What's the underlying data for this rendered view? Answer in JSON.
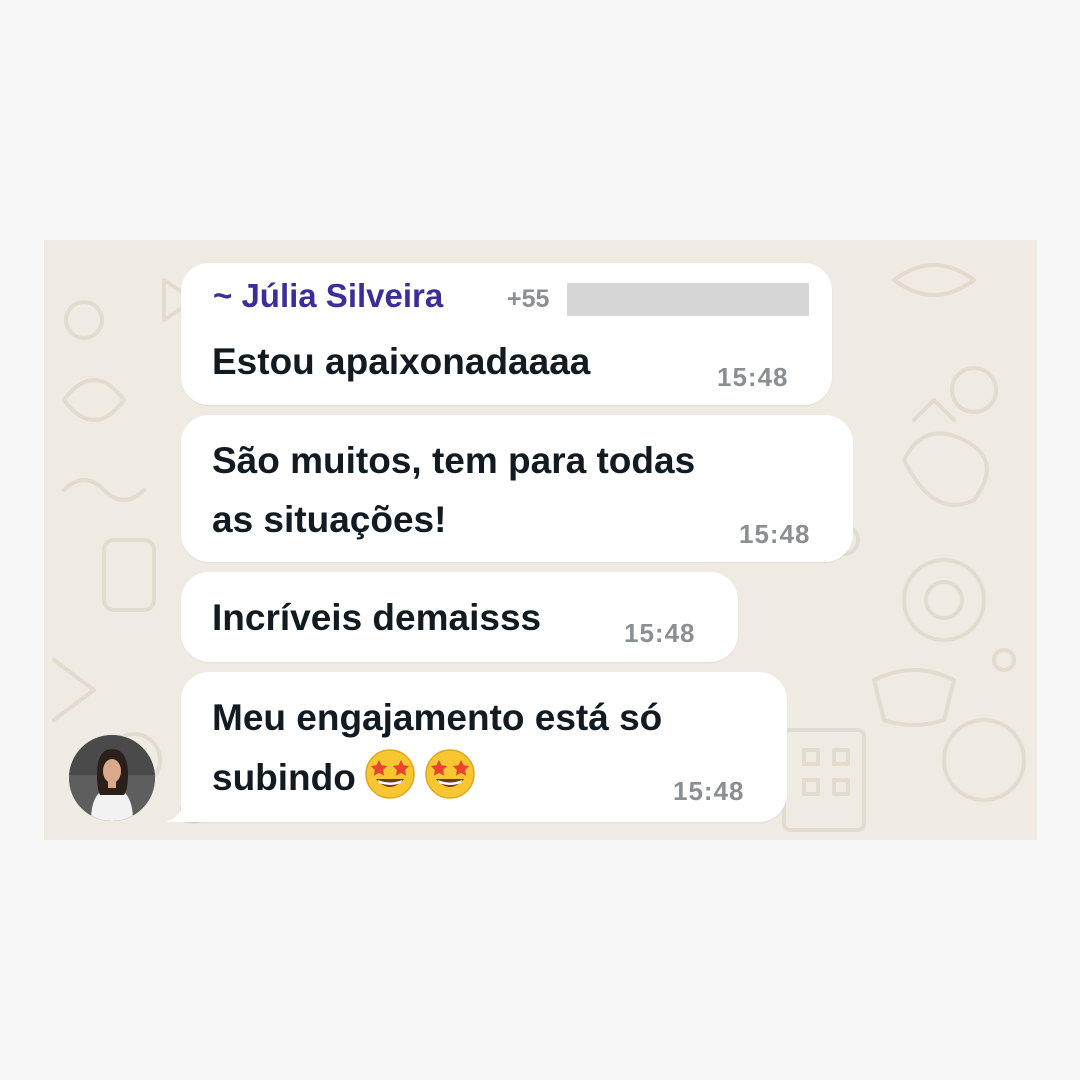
{
  "chat": {
    "group_sender": {
      "name": "~ Júlia Silveira",
      "phone_prefix": "+55"
    },
    "messages": [
      {
        "text_lines": [
          "Estou apaixonadaaaa"
        ],
        "time": "15:48"
      },
      {
        "text_lines": [
          "São muitos, tem para todas",
          "as situações!"
        ],
        "time": "15:48"
      },
      {
        "text_lines": [
          "Incríveis demaisss"
        ],
        "time": "15:48"
      },
      {
        "text_lines": [
          "Meu engajamento está só",
          "subindo"
        ],
        "time": "15:48",
        "emojis": [
          "star-struck-emoji",
          "star-struck-emoji"
        ]
      }
    ]
  },
  "colors": {
    "sender_name": "#3c2e9a",
    "bubble": "#ffffff",
    "wallpaper": "#efeae2",
    "timestamp": "#8a8f93"
  }
}
